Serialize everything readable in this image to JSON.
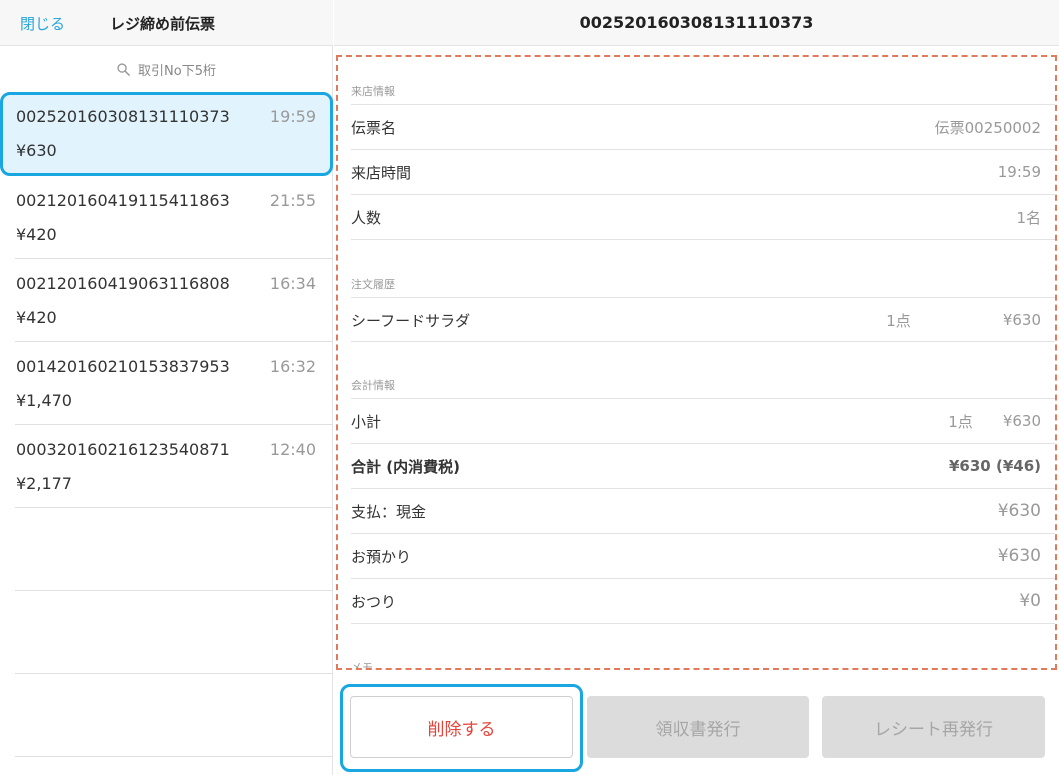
{
  "left_header": {
    "close_label": "閉じる",
    "title": "レジ締め前伝票"
  },
  "search": {
    "placeholder": "取引No下5桁",
    "icon": "search-icon"
  },
  "transactions": [
    {
      "no": "00252016030813111O373",
      "time": "19:59",
      "amount": "¥630",
      "selected": true
    },
    {
      "no": "00212016041911541186З",
      "time": "21:55",
      "amount": "¥420"
    },
    {
      "no": "00212016041906311680B",
      "time": "16:34",
      "amount": "¥420"
    },
    {
      "no": "00142016021015383795З",
      "time": "16:32",
      "amount": "¥1,470"
    },
    {
      "no": "000320160216123540871",
      "time": "12:40",
      "amount": "¥2,177"
    }
  ],
  "detail_header": {
    "title": "00252016030813111O373"
  },
  "visit_info": {
    "section": "来店情報",
    "rows": [
      {
        "label": "伝票名",
        "value": "伝票00250002"
      },
      {
        "label": "来店時間",
        "value": "19:59"
      },
      {
        "label": "人数",
        "value": "1名"
      }
    ]
  },
  "order_history": {
    "section": "注文履歴",
    "items": [
      {
        "name": "シーフードサラダ",
        "qty": "1点",
        "price": "¥630"
      }
    ]
  },
  "accounting": {
    "section": "会計情報",
    "subtotal": {
      "label": "小計",
      "qty": "1点",
      "value": "¥630"
    },
    "total": {
      "label": "合計 (内消費税)",
      "value": "¥630 (¥46)"
    },
    "payment": {
      "label": "支払：現金",
      "value": "¥630"
    },
    "deposit": {
      "label": "お預かり",
      "value": "¥630"
    },
    "change": {
      "label": "おつり",
      "value": "¥0"
    }
  },
  "memo": {
    "section": "メモ"
  },
  "buttons": {
    "delete": "削除する",
    "receipt": "領収書発行",
    "reissue": "レシート再発行"
  },
  "colors": {
    "accent": "#27a5dd",
    "highlight_border": "#18a7e0",
    "selected_bg": "#e1f3fd",
    "dashed_border": "#e07a5a",
    "delete_text": "#e5443b"
  }
}
